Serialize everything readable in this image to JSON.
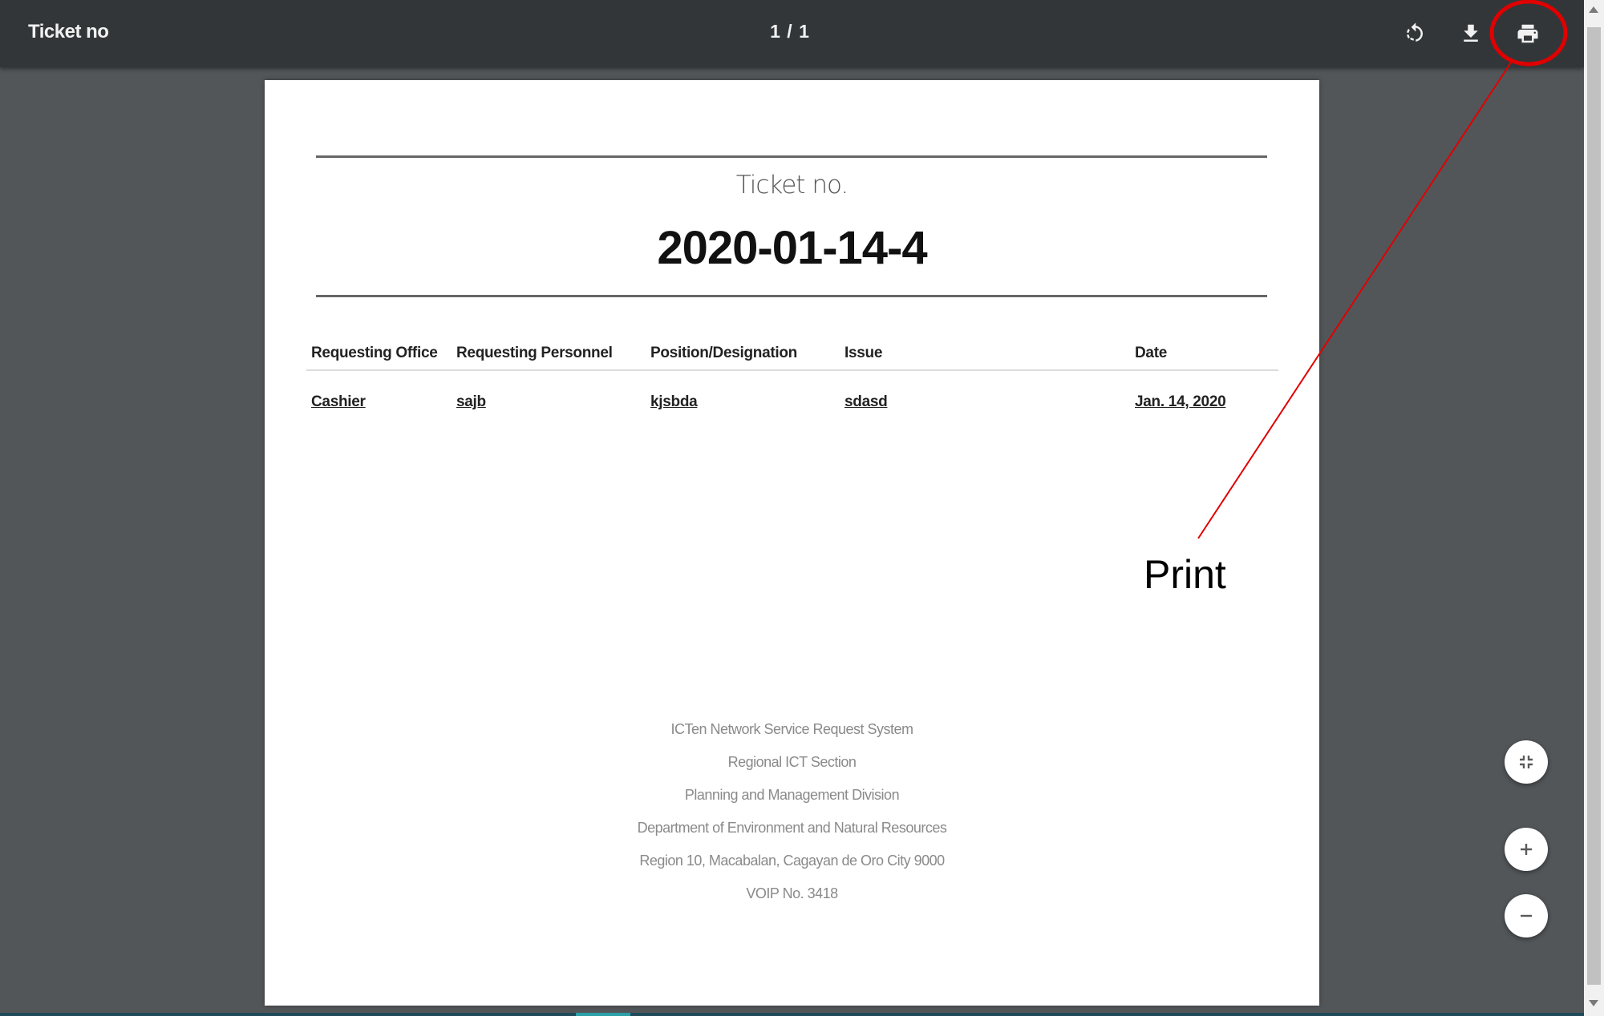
{
  "toolbar": {
    "title": "Ticket no",
    "page_indicator": "1 / 1",
    "rotate_icon": "rotate-icon",
    "download_icon": "download-icon",
    "print_icon": "print-icon"
  },
  "document": {
    "ticket_label": "Ticket no.",
    "ticket_number": "2020-01-14-4",
    "table": {
      "headers": [
        "Requesting Office",
        "Requesting Personnel",
        "Position/Designation",
        "Issue",
        "Date"
      ],
      "row": [
        "Cashier",
        "sajb",
        "kjsbda",
        "sdasd",
        "Jan. 14, 2020"
      ]
    },
    "footer": [
      "ICTen Network Service Request System",
      "Regional ICT Section",
      "Planning and Management Division",
      "Department of Environment and Natural Resources",
      "Region 10, Macabalan, Cagayan de Oro City 9000",
      "VOIP No. 3418"
    ]
  },
  "annotation": {
    "label": "Print",
    "color": "#e00000"
  },
  "zoom_controls": {
    "fit_icon": "fit-to-page-icon",
    "zoom_in_icon": "plus-icon",
    "zoom_out_icon": "minus-icon"
  }
}
